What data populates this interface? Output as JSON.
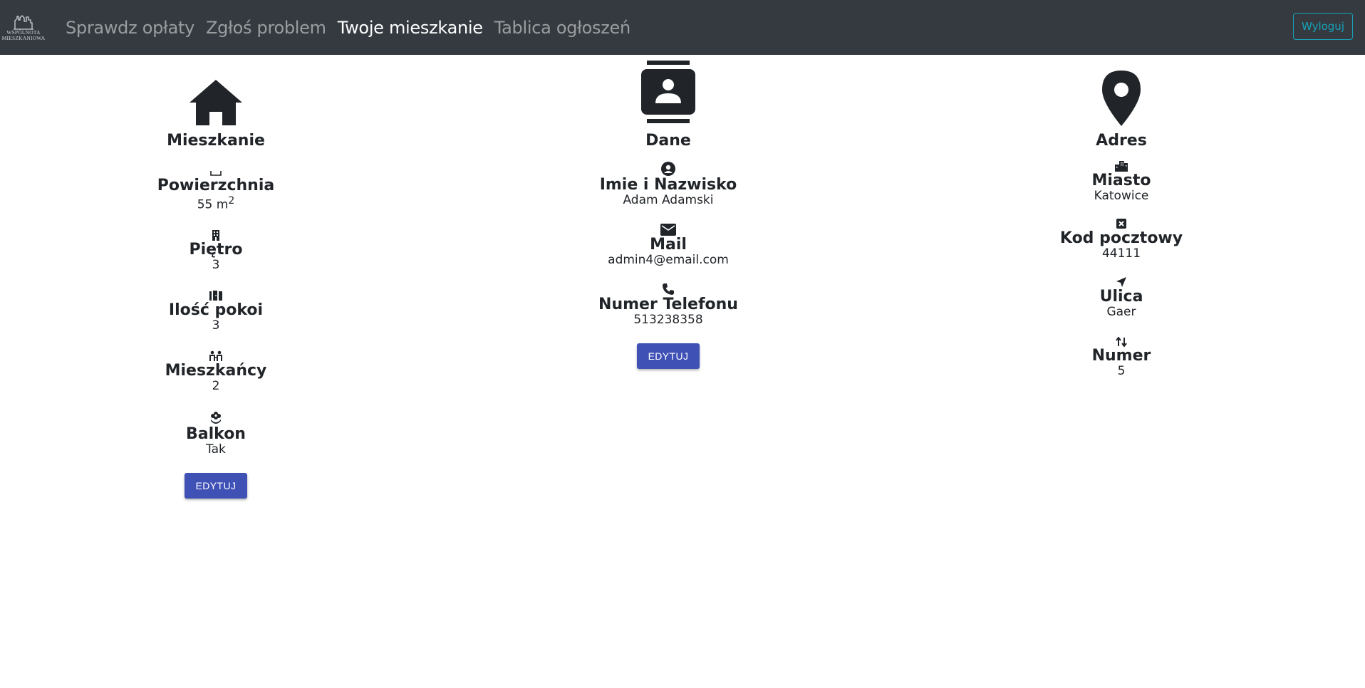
{
  "brand": {
    "line1": "WSPÓLNOTA",
    "line2": "MIESZKANIOWA"
  },
  "nav": {
    "items": [
      {
        "label": "Sprawdz opłaty"
      },
      {
        "label": "Zgłoś problem"
      },
      {
        "label": "Twoje mieszkanie"
      },
      {
        "label": "Tablica ogłoszeń"
      }
    ],
    "active": "Twoje mieszkanie",
    "logout_label": "Wyloguj"
  },
  "mieszkanie": {
    "title": "Mieszkanie",
    "powierzchnia": {
      "label": "Powierzchnia",
      "value": "55 m",
      "unit_sup": "2"
    },
    "pietro": {
      "label": "Piętro",
      "value": "3"
    },
    "pokoje": {
      "label": "Ilość pokoi",
      "value": "3"
    },
    "mieszkancy": {
      "label": "Mieszkańcy",
      "value": "2"
    },
    "balkon": {
      "label": "Balkon",
      "value": "Tak"
    },
    "edit_label": "EDYTUJ"
  },
  "dane": {
    "title": "Dane",
    "imie": {
      "label": "Imie i Nazwisko",
      "value": "Adam Adamski"
    },
    "mail": {
      "label": "Mail",
      "value": "admin4@email.com"
    },
    "telefon": {
      "label": "Numer Telefonu",
      "value": "513238358"
    },
    "edit_label": "EDYTUJ"
  },
  "adres": {
    "title": "Adres",
    "miasto": {
      "label": "Miasto",
      "value": "Katowice"
    },
    "kod": {
      "label": "Kod pocztowy",
      "value": "44111"
    },
    "ulica": {
      "label": "Ulica",
      "value": "Gaer"
    },
    "numer": {
      "label": "Numer",
      "value": "5"
    }
  },
  "colors": {
    "navbar": "#343a40",
    "button": "#3f51b5",
    "logout": "#17a2b8"
  }
}
